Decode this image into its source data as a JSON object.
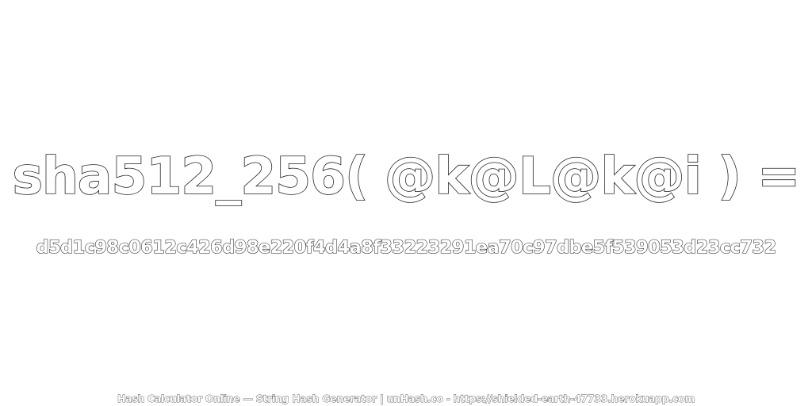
{
  "expression": "sha512_256( @k@L@k@i ) =",
  "hash_value": "d5d1c98c0612c426d98e220f4d4a8f33223291ea70c97dbe5f539053d23cc732",
  "footer": "Hash Calculator Online — String Hash Generator | unHash.co - https://shielded-earth-47733.herokuapp.com",
  "colors": {
    "background": "#ffffff",
    "text_fill": "#ffffff",
    "text_outline": "#222222"
  }
}
